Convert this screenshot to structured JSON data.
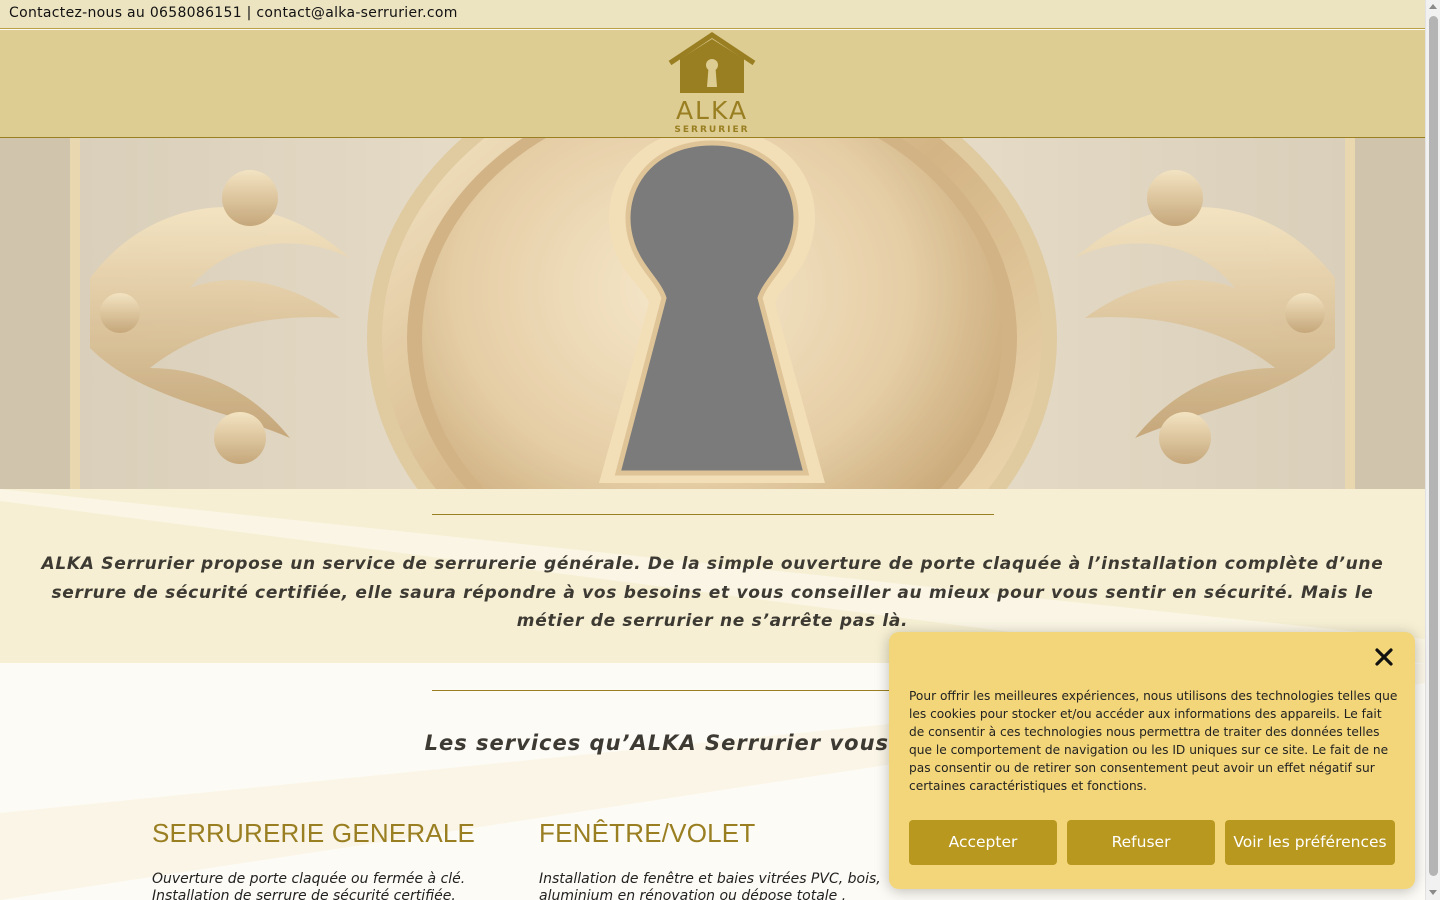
{
  "topbar": {
    "contact": "Contactez-nous au 0658086151 | contact@alka-serrurier.com"
  },
  "logo": {
    "name": "ALKA",
    "sub": "SERRURIER"
  },
  "intro": {
    "text": "ALKA Serrurier propose un service de serrurerie générale. De la simple ouverture de porte claquée à l’installation complète d’une serrure de sécurité certifiée, elle saura répondre à vos besoins et vous conseiller au mieux pour vous sentir en sécurité. Mais le métier de serrurier ne s’arrête pas là."
  },
  "services": {
    "title": "Les services qu’ALKA Serrurier vous propose",
    "items": [
      {
        "title": "SERRURERIE GENERALE",
        "text": "Ouverture de porte claquée ou fermée à clé. Installation de serrure de sécurité certifiée."
      },
      {
        "title": "FENÊTRE/VOLET",
        "text": "Installation de fenêtre et baies vitrées PVC, bois, aluminium en rénovation ou dépose totale ."
      }
    ]
  },
  "cookie": {
    "text": "Pour offrir les meilleures expériences, nous utilisons des technologies telles que les cookies pour stocker et/ou accéder aux informations des appareils. Le fait de consentir à ces technologies nous permettra de traiter des données telles que le comportement de navigation ou les ID uniques sur ce site. Le fait de ne pas consentir ou de retirer son consentement peut avoir un effet négatif sur certaines caractéristiques et fonctions.",
    "accept": "Accepter",
    "refuse": "Refuser",
    "prefs": "Voir les préférences"
  },
  "colors": {
    "gold": "#9a7f22",
    "header_bg": "#ddcd93",
    "topbar_bg": "#ece3c1",
    "cookie_bg": "#f3d67a",
    "button": "#b8981f"
  }
}
